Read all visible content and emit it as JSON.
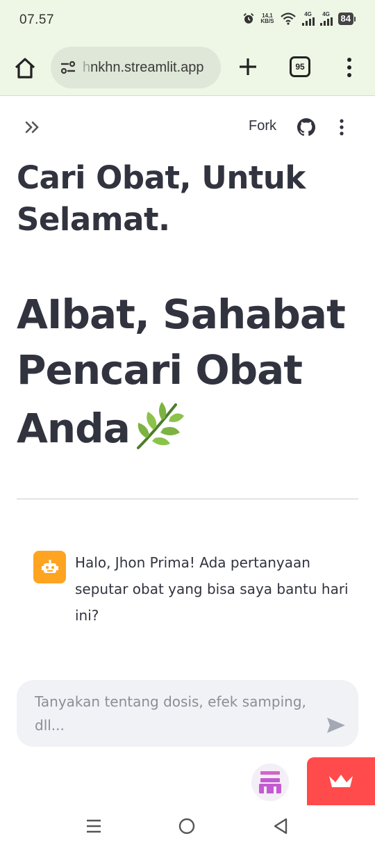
{
  "status_bar": {
    "time": "07.57",
    "net_speed_value": "14,1",
    "net_speed_unit": "KB/S",
    "signal_1_label": "4G",
    "signal_2_label": "4G",
    "battery": "84"
  },
  "browser": {
    "url_faded": "h",
    "url_text": "nkhn.streamlit.app",
    "tab_count": "95"
  },
  "app_header": {
    "fork_label": "Fork"
  },
  "main": {
    "title_line": "Cari Obat, Untuk Selamat.",
    "headline": "AIbat, Sahabat Pencari Obat Anda"
  },
  "chat": {
    "bot_message": "Halo, Jhon Prima! Ada pertanyaan seputar obat yang bisa saya bantu hari ini?",
    "input_placeholder": "Tanyakan tentang dosis, efek samping, dll..."
  },
  "icons": {
    "home": "home-icon",
    "site_settings": "tune-icon",
    "new_tab": "plus-icon",
    "tabs": "tab-switcher-icon",
    "menu": "more-vert-icon",
    "sidebar": "double-chevron-right-icon",
    "github": "github-icon",
    "leaf": "herb-leaf-icon",
    "bot": "robot-icon",
    "send": "send-icon",
    "crown": "crown-icon",
    "nav_recent": "menu-lines-icon",
    "nav_home": "circle-icon",
    "nav_back": "triangle-back-icon"
  },
  "colors": {
    "browser_bar": "#eef7e6",
    "text": "#31333f",
    "bot_avatar": "#ffa421",
    "streamlit_red": "#ff4b4b",
    "chat_input_bg": "#f0f2f6"
  }
}
